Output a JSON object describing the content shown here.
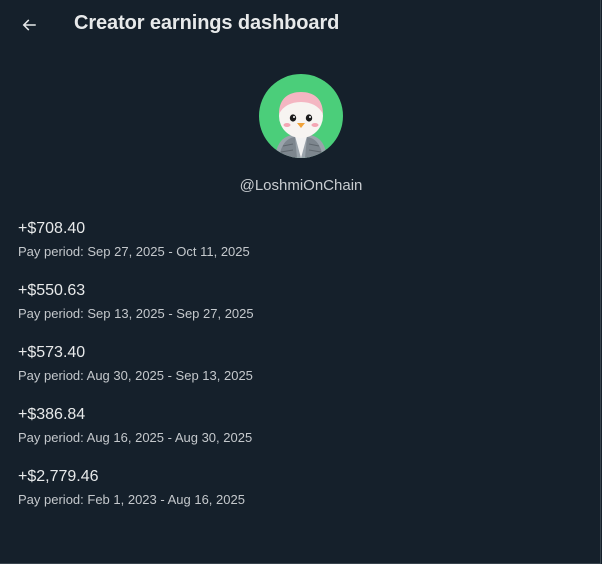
{
  "header": {
    "title": "Creator earnings dashboard",
    "back_icon": "arrow-left-icon"
  },
  "profile": {
    "handle": "@LoshmiOnChain",
    "avatar_bg": "#4bce7a"
  },
  "payouts": [
    {
      "amount": "+$708.40",
      "period": "Pay period: Sep 27, 2025 - Oct 11, 2025"
    },
    {
      "amount": "+$550.63",
      "period": "Pay period: Sep 13, 2025 - Sep 27, 2025"
    },
    {
      "amount": "+$573.40",
      "period": "Pay period: Aug 30, 2025 - Sep 13, 2025"
    },
    {
      "amount": "+$386.84",
      "period": "Pay period: Aug 16, 2025 - Aug 30, 2025"
    },
    {
      "amount": "+$2,779.46",
      "period": "Pay period: Feb 1, 2023 - Aug 16, 2025"
    }
  ],
  "colors": {
    "background": "#15202b",
    "text": "#e7e9ea"
  }
}
